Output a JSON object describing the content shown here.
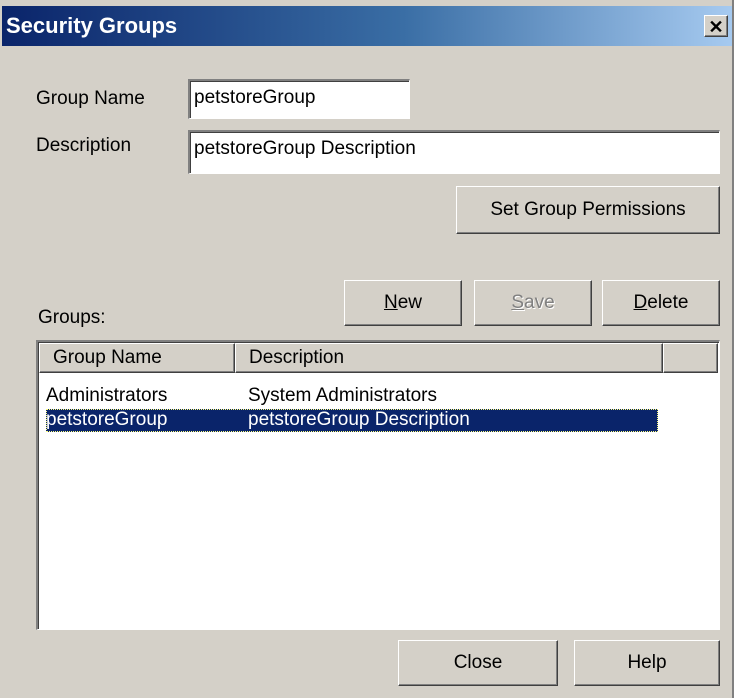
{
  "window": {
    "title": "Security Groups",
    "close_glyph": "✕"
  },
  "form": {
    "group_name_label": "Group Name",
    "group_name_value": "petstoreGroup",
    "description_label": "Description",
    "description_value": "petstoreGroup Description",
    "set_permissions_label": "Set Group Permissions"
  },
  "groups": {
    "label": "Groups:",
    "buttons": {
      "new": "New",
      "save": "Save",
      "delete": "Delete"
    },
    "columns": [
      "Group Name",
      "Description"
    ],
    "rows": [
      {
        "name": "Administrators",
        "description": "System Administrators",
        "selected": false
      },
      {
        "name": "petstoreGroup",
        "description": "petstoreGroup Description",
        "selected": true
      }
    ]
  },
  "footer": {
    "close": "Close",
    "help": "Help"
  },
  "colors": {
    "titlebar_start": "#0a246a",
    "titlebar_end": "#a6caf0",
    "selection": "#0a246a",
    "dialog_bg": "#d4d0c8"
  }
}
